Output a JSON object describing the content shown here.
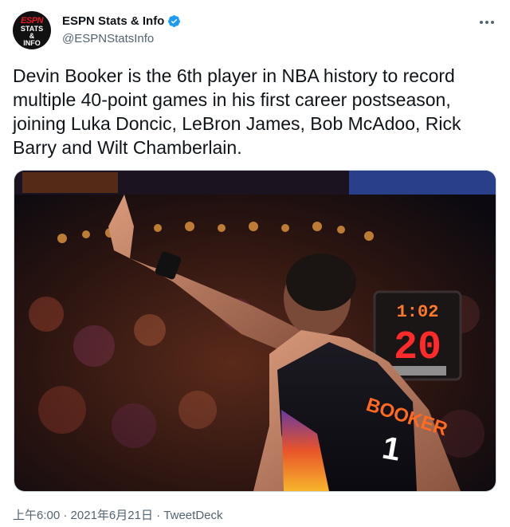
{
  "author": {
    "name": "ESPN Stats & Info",
    "handle": "@ESPNStatsInfo",
    "avatar_top": "ESPN",
    "avatar_bottom_1": "STATS",
    "avatar_bottom_2": "&",
    "avatar_bottom_3": "INFO"
  },
  "tweet": {
    "text": "Devin Booker is the 6th player in NBA history to record multiple 40-point games in his first career postseason, joining Luka Doncic, LeBron James, Bob McAdoo, Rick Barry and Wilt Chamberlain."
  },
  "photo": {
    "jersey_name": "BOOKER",
    "jersey_number": "1",
    "shot_clock_top": "1:02",
    "shot_clock": "20"
  },
  "meta": {
    "time": "上午6:00",
    "separator1": " · ",
    "date": "2021年6月21日",
    "separator2": " · ",
    "source": "TweetDeck"
  },
  "colors": {
    "verified": "#1d9bf0",
    "text": "#0f1419",
    "muted": "#536471"
  }
}
